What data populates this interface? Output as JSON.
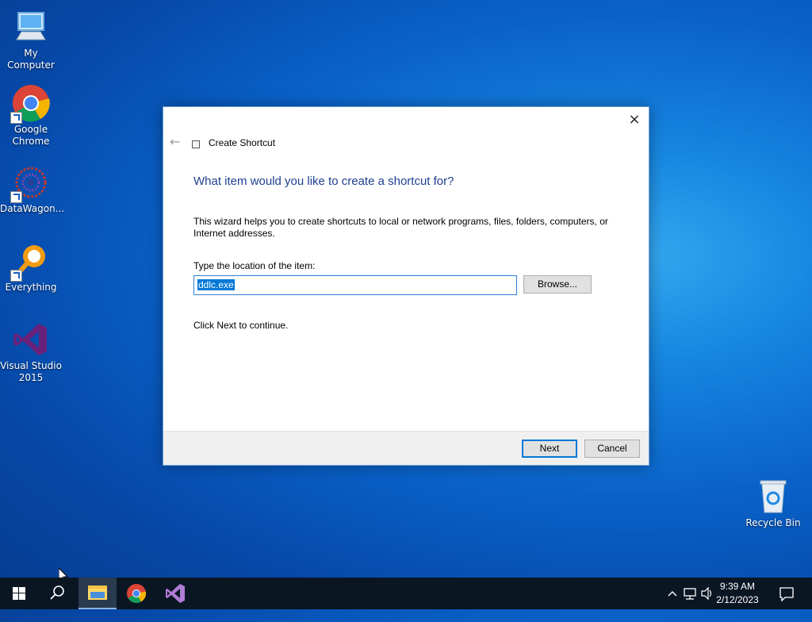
{
  "desktop": {
    "icons": [
      {
        "label": "My Computer"
      },
      {
        "label": "Google Chrome"
      },
      {
        "label": "DataWagon..."
      },
      {
        "label": "Everything"
      },
      {
        "label": "Visual Studio 2015"
      },
      {
        "label": "Recycle Bin"
      }
    ]
  },
  "dialog": {
    "window_title": "Create Shortcut",
    "close_glyph": "×",
    "back_glyph": "←",
    "heading": "What item would you like to create a shortcut for?",
    "description": "This wizard helps you to create shortcuts to local or network programs, files, folders, computers, or Internet addresses.",
    "location_label": "Type the location of the item:",
    "location_value": "ddlc.exe",
    "browse_label": "Browse...",
    "continue_text": "Click Next to continue.",
    "next_label": "Next",
    "cancel_label": "Cancel"
  },
  "taskbar": {
    "clock_time": "9:39 AM",
    "clock_date": "2/12/2023",
    "accent": "#0078d7"
  }
}
